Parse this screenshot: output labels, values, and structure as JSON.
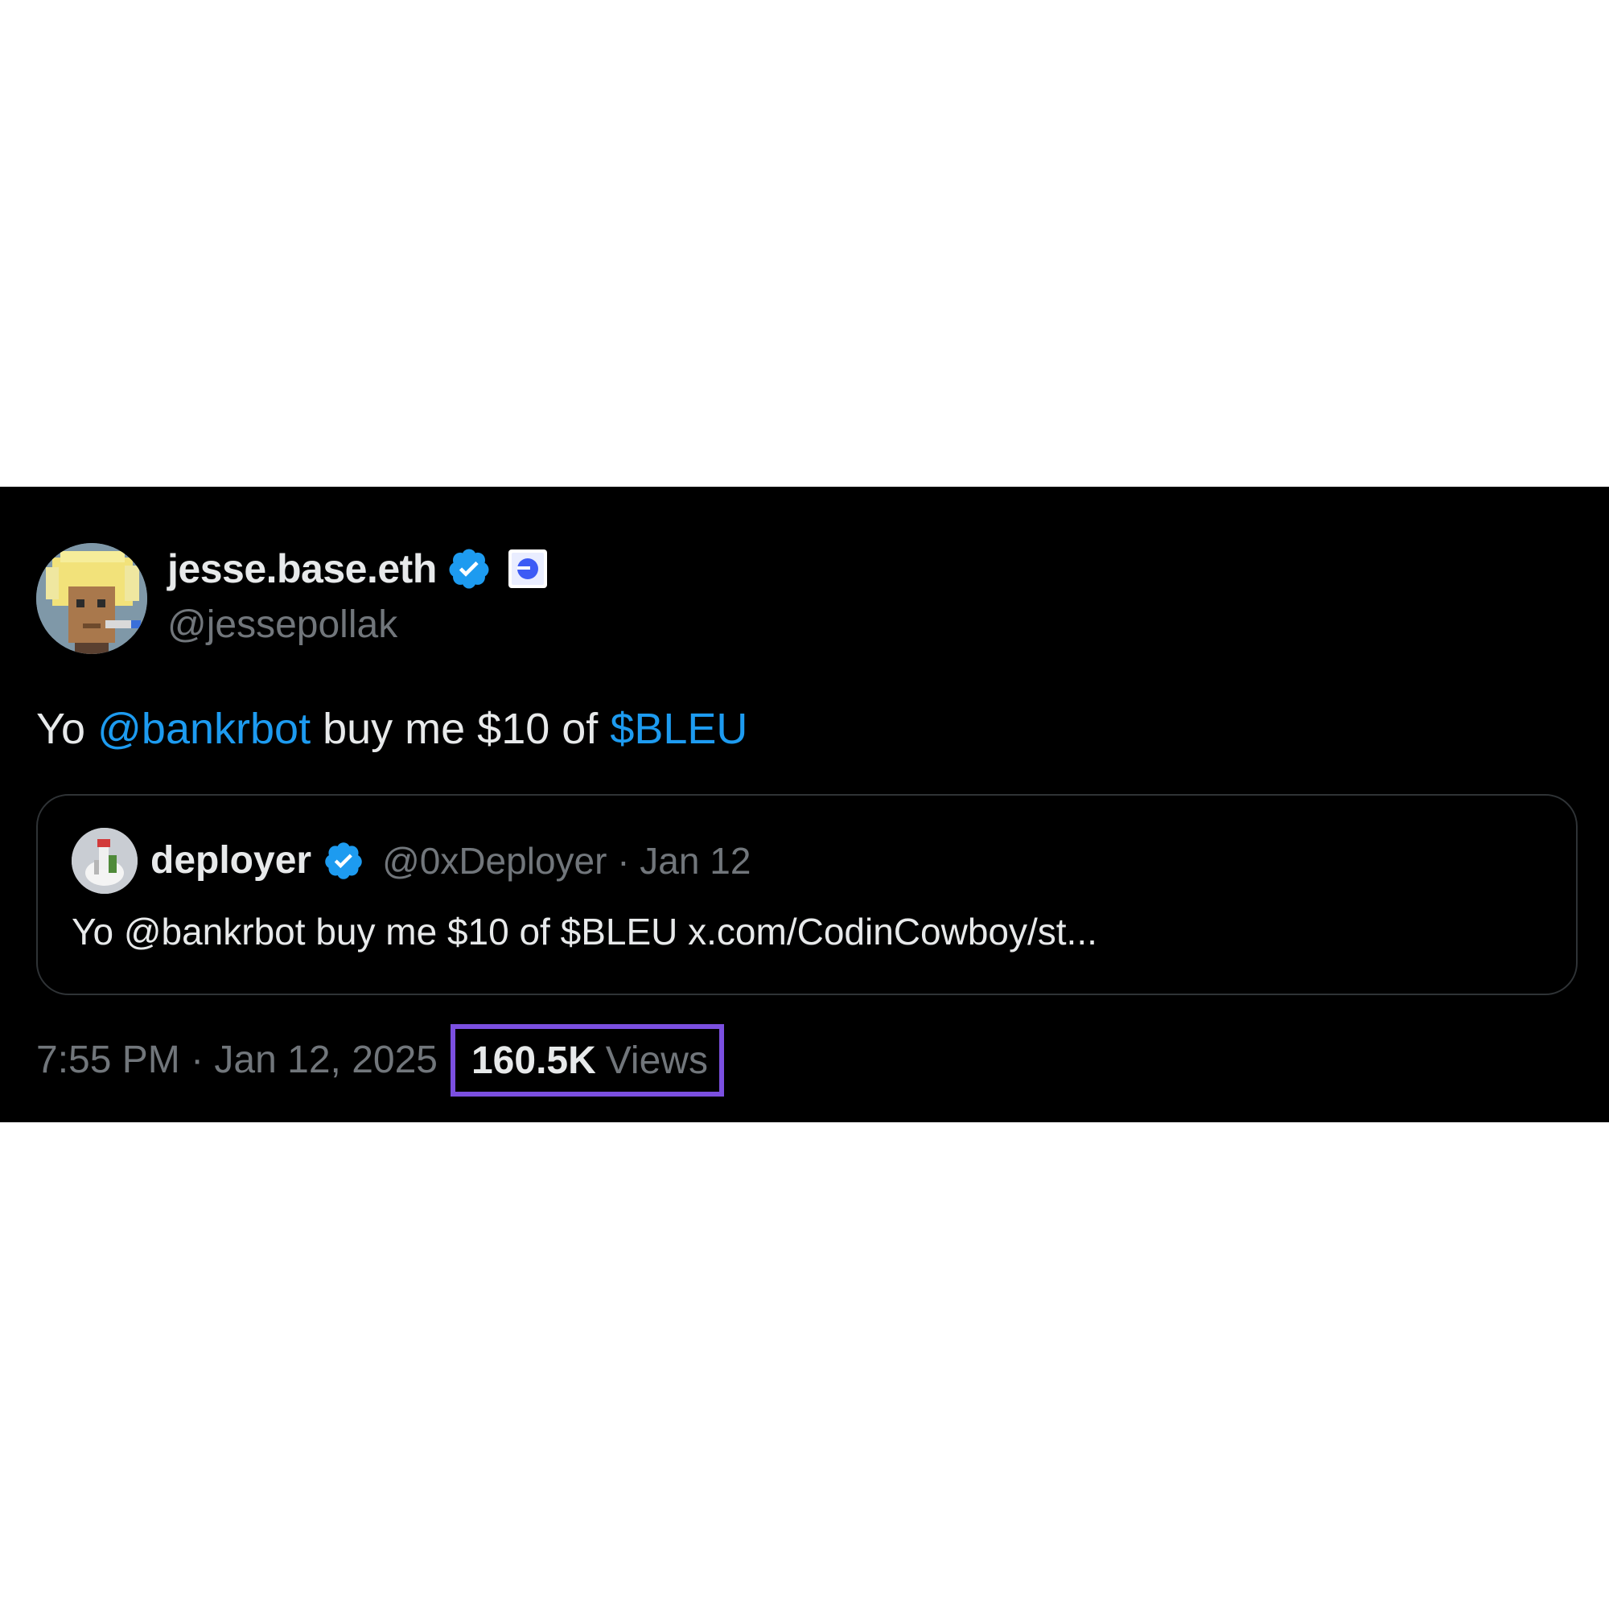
{
  "author": {
    "display_name": "jesse.base.eth",
    "handle": "@jessepollak",
    "verified_icon": "verified-badge-icon",
    "affiliation_icon": "base-affiliate-badge-icon"
  },
  "tweet": {
    "text_prefix": "Yo ",
    "mention": "@bankrbot",
    "text_middle": " buy me $10 of ",
    "cashtag": "$BLEU"
  },
  "quoted_tweet": {
    "display_name": "deployer",
    "handle_and_date": "@0xDeployer · Jan 12",
    "text": "Yo @bankrbot buy me $10 of $BLEU x.com/CodinCowboy/st..."
  },
  "meta": {
    "timestamp": "7:55 PM · Jan 12, 2025",
    "views_count": "160.5K",
    "views_label": "Views"
  },
  "colors": {
    "background": "#000000",
    "text_primary": "#e7e9ea",
    "text_secondary": "#71767b",
    "link": "#1d9bf0",
    "verified": "#1d9bf0",
    "highlight_box": "#7b4fe0"
  }
}
